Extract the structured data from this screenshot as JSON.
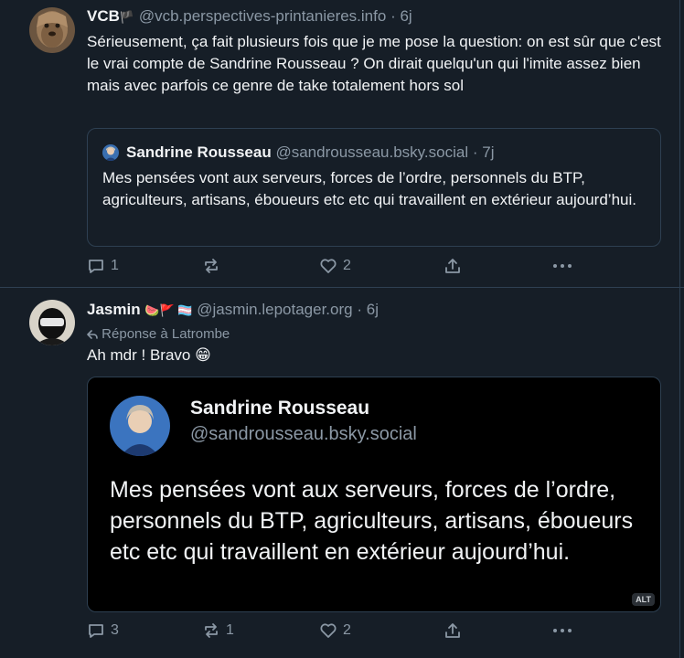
{
  "post1": {
    "author_name": "VCB",
    "author_flag": "🏴",
    "author_handle": "@vcb.perspectives-printanieres.info",
    "separator": "·",
    "time": "6j",
    "text": "Sérieusement, ça fait plusieurs fois que je me pose la question: on est sûr que c'est le vrai compte de Sandrine Rousseau ? On dirait quelqu'un qui l'imite assez bien mais avec parfois ce genre de take totalement hors sol",
    "quote": {
      "author_name": "Sandrine Rousseau",
      "author_handle": "@sandrousseau.bsky.social",
      "separator": "·",
      "time": "7j",
      "text": "Mes pensées vont aux serveurs, forces de l’ordre, personnels du BTP, agriculteurs, artisans, éboueurs etc etc qui travaillent en extérieur aujourd’hui."
    },
    "actions": {
      "replies": "1",
      "reposts": "",
      "likes": "2"
    }
  },
  "post2": {
    "author_name": "Jasmin",
    "author_emojis": "🍉🚩 🏳️‍⚧️",
    "author_handle": "@jasmin.lepotager.org",
    "separator": "·",
    "time": "6j",
    "reply_to": "Réponse à Latrombe",
    "text": "Ah mdr ! Bravo 😁",
    "image": {
      "name": "Sandrine Rousseau",
      "handle": "@sandrousseau.bsky.social",
      "text": "Mes pensées vont aux serveurs, forces de l’ordre, personnels du BTP, agriculteurs, artisans, éboueurs etc etc qui travaillent en extérieur aujourd’hui.",
      "alt_label": "ALT"
    },
    "actions": {
      "replies": "3",
      "reposts": "1",
      "likes": "2"
    }
  },
  "colors": {
    "background": "#161e27",
    "border": "#2e4052",
    "muted": "#8b98a5",
    "text": "#f1f3f5"
  }
}
